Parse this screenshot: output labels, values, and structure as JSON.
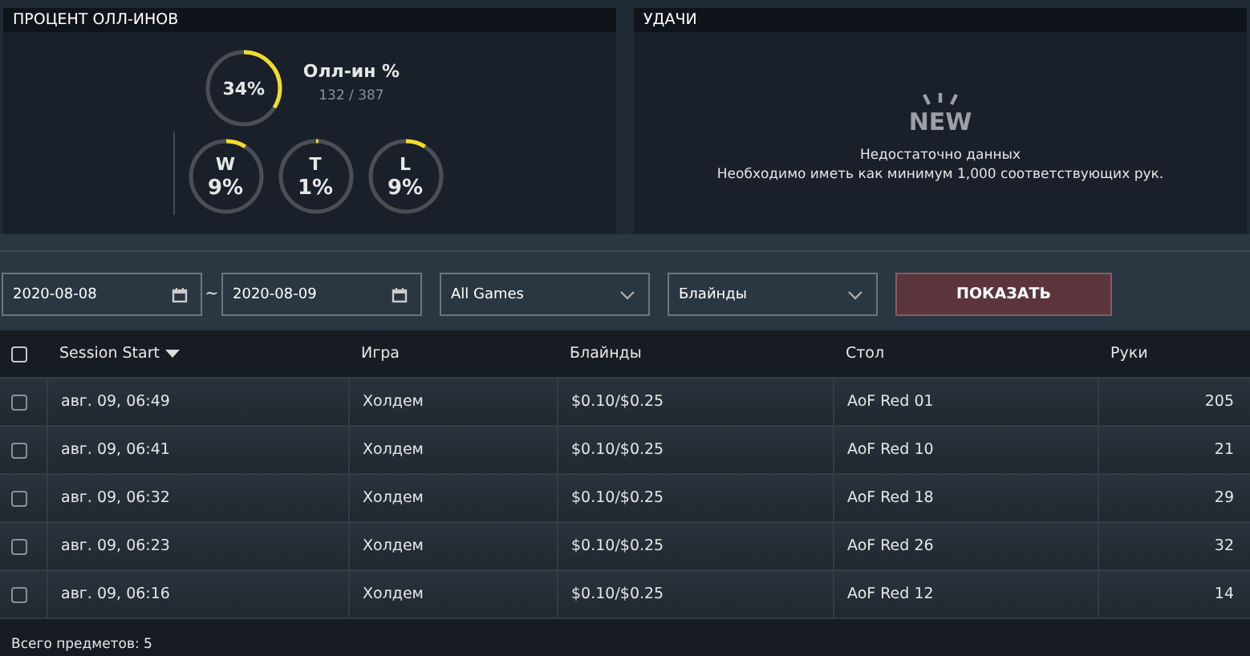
{
  "allin_panel": {
    "title": "ПРОЦЕНТ ОЛЛ-ИНОВ",
    "main": {
      "value": "34%",
      "level": 0.34,
      "label": "Олл-ин %",
      "count": "132 / 387"
    },
    "rings": [
      {
        "letter": "W",
        "value": "9%",
        "level": 0.09
      },
      {
        "letter": "T",
        "value": "1%",
        "level": 0.01
      },
      {
        "letter": "L",
        "value": "9%",
        "level": 0.09
      }
    ]
  },
  "luck_panel": {
    "title": "УДАЧИ",
    "badge": "NEW",
    "message": "Недостаточно данных",
    "detail": "Необходимо иметь как минимум 1,000 соответствующих рук."
  },
  "filters": {
    "date_from": "2020-08-08",
    "separator": "~",
    "date_to": "2020-08-09",
    "game": "All Games",
    "blinds": "Блайнды",
    "button": "ПОКАЗАТЬ"
  },
  "table": {
    "select_all": {
      "checked": false
    },
    "columns": [
      {
        "label": "Session Start",
        "sorted": true
      },
      {
        "label": "Игра",
        "sorted": false
      },
      {
        "label": "Блайнды",
        "sorted": false
      },
      {
        "label": "Стол",
        "sorted": false
      },
      {
        "label": "Руки",
        "sorted": false
      }
    ],
    "rows": [
      {
        "checked": false,
        "cells": [
          "авг. 09, 06:49",
          "Холдем",
          "$0.10/$0.25",
          "AoF Red 01",
          "205"
        ]
      },
      {
        "checked": false,
        "cells": [
          "авг. 09, 06:41",
          "Холдем",
          "$0.10/$0.25",
          "AoF Red 10",
          "21"
        ]
      },
      {
        "checked": false,
        "cells": [
          "авг. 09, 06:32",
          "Холдем",
          "$0.10/$0.25",
          "AoF Red 18",
          "29"
        ]
      },
      {
        "checked": false,
        "cells": [
          "авг. 09, 06:23",
          "Холдем",
          "$0.10/$0.25",
          "AoF Red 26",
          "32"
        ]
      },
      {
        "checked": false,
        "cells": [
          "авг. 09, 06:16",
          "Холдем",
          "$0.10/$0.25",
          "AoF Red 12",
          "14"
        ]
      }
    ]
  },
  "status_bar": {
    "total": "Всего предметов: 5"
  }
}
